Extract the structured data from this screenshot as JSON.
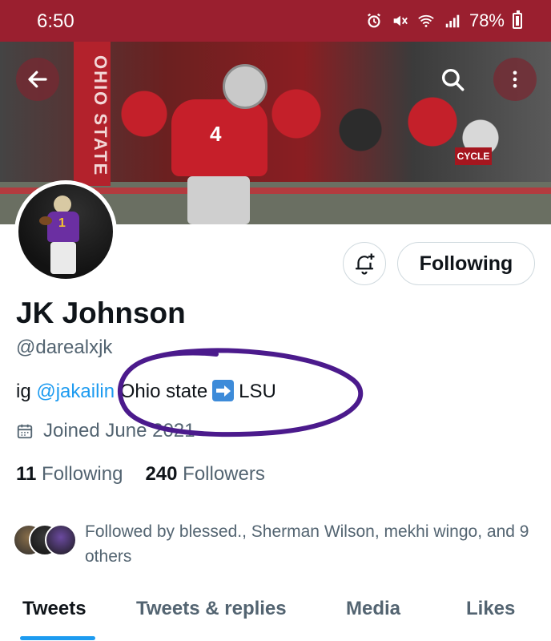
{
  "status_bar": {
    "time": "6:50",
    "battery": "78%"
  },
  "banner": {
    "pillar_text": "OHIO STATE",
    "jersey_number": "4",
    "sign_text": "CYCLE"
  },
  "profile": {
    "name": "JK Johnson",
    "handle": "@darealxjk",
    "bio": {
      "prefix": "ig ",
      "mention": "@jakailin",
      "text_before": "Ohio state",
      "text_after": "LSU"
    },
    "joined": "Joined June 2021",
    "avatar_number": "1"
  },
  "actions": {
    "following_label": "Following"
  },
  "stats": {
    "following_count": "11",
    "following_label": "Following",
    "followers_count": "240",
    "followers_label": "Followers"
  },
  "followed_by": {
    "text": "Followed by blessed., Sherman Wilson, mekhi wingo, and 9 others"
  },
  "tabs": [
    {
      "label": "Tweets",
      "active": true
    },
    {
      "label": "Tweets & replies",
      "active": false
    },
    {
      "label": "Media",
      "active": false
    },
    {
      "label": "Likes",
      "active": false
    }
  ],
  "colors": {
    "status_bar": "#9a1f2f",
    "link": "#1d9bf0",
    "secondary_text": "#536471",
    "annotation": "#4b1a8c"
  },
  "icons": [
    "back-arrow-icon",
    "search-icon",
    "more-vertical-icon",
    "bell-plus-icon",
    "calendar-icon",
    "alarm-icon",
    "mute-icon",
    "wifi-icon",
    "signal-icon",
    "battery-icon"
  ]
}
